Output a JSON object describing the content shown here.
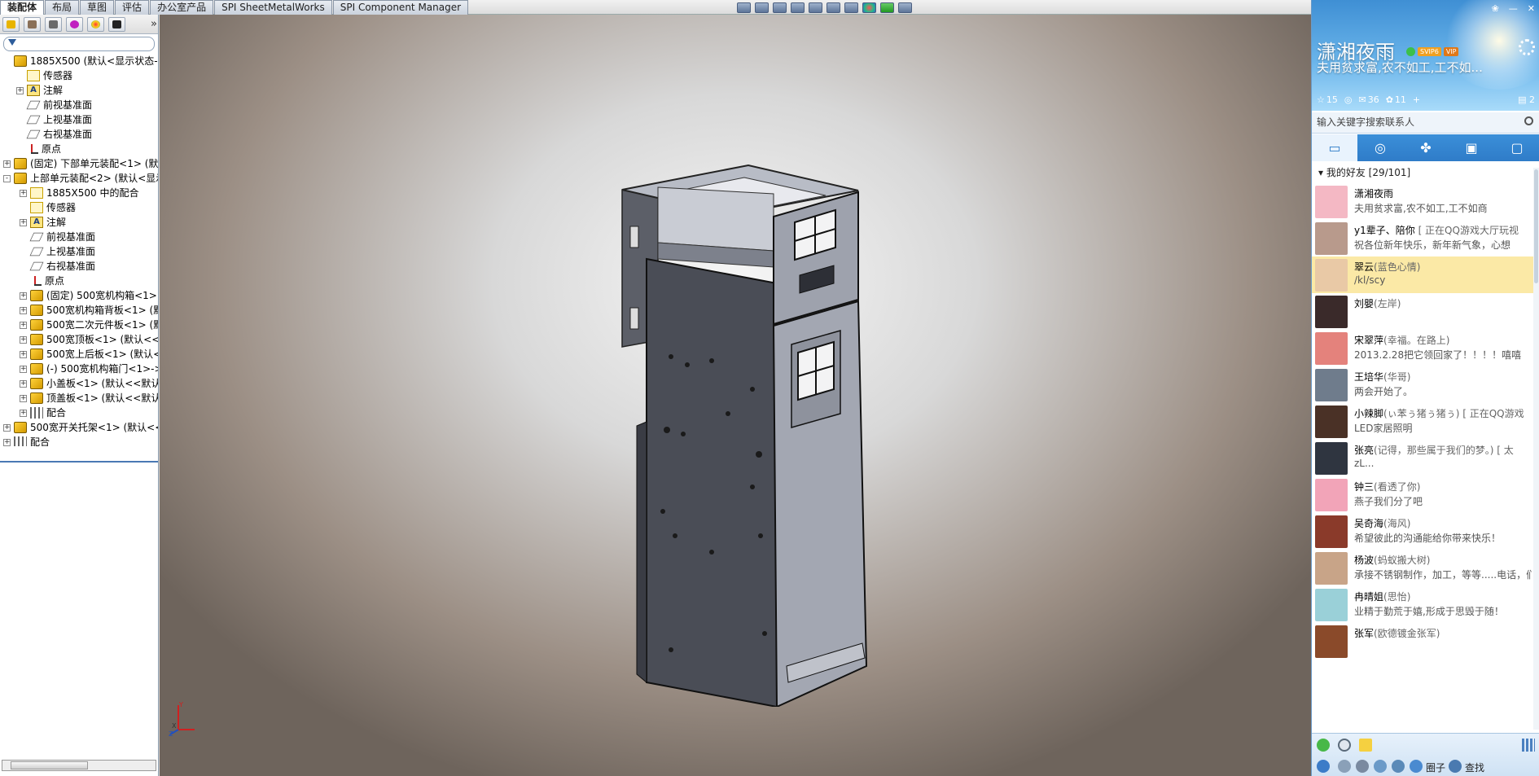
{
  "tabs": [
    "装配体",
    "布局",
    "草图",
    "评估",
    "办公室产品",
    "SPI SheetMetalWorks",
    "SPI Component Manager"
  ],
  "view_toolbar_icons": [
    "zoom-to-fit-icon",
    "zoom-area-icon",
    "previous-view-icon",
    "section-view-icon",
    "view-orientation-icon",
    "display-style-icon",
    "hide-show-icon",
    "edit-appearance-icon",
    "apply-scene-icon",
    "view-settings-icon"
  ],
  "tree": {
    "root": "1885X500 (默认<显示状态-1>)",
    "sensors": "传感器",
    "annotations": "注解",
    "front_plane": "前视基准面",
    "top_plane": "上视基准面",
    "right_plane": "右视基准面",
    "origin": "原点",
    "lower_unit": "(固定) 下部单元装配<1> (默认",
    "upper_unit": "上部单元装配<2> (默认<显示",
    "mates_in": "1885X500 中的配合",
    "sub_sensors": "传感器",
    "sub_annotations": "注解",
    "sub_front": "前视基准面",
    "sub_top": "上视基准面",
    "sub_right": "右视基准面",
    "sub_origin": "原点",
    "box": "(固定) 500宽机构箱<1> -:",
    "box_back": "500宽机构箱背板<1> (默认",
    "secondary_plate": "500宽二次元件板<1> (默认",
    "top_plate": "500宽顶板<1> (默认<<默",
    "upper_back": "500宽上后板<1> (默认<<",
    "box_door": "(-) 500宽机构箱门<1>->?",
    "small_cover": "小盖板<1> (默认<<默认",
    "top_cover": "顶盖板<1> (默认<<默认:",
    "sub_mates": "配合",
    "switch_bracket": "500宽开关托架<1> (默认<<默",
    "mates": "配合"
  },
  "qq": {
    "nickname": "潇湘夜雨",
    "signature": "夫用贫求富,农不如工,工不如...",
    "badge_vip": "SVIP6",
    "badge_level": "VIP",
    "stats": {
      "favorites": "15",
      "mail": "36",
      "qzone": "11",
      "right_count": "2"
    },
    "search_placeholder": "输入关键字搜索联系人",
    "group_label": "我的好友  [29/101]",
    "friends": [
      {
        "name": "潇湘夜雨",
        "remark": "",
        "sig": "夫用贫求富,农不如工,工不如商",
        "avatar_color": "#f4b8c4"
      },
      {
        "name": "y1辈子、陪你",
        "remark": " [ 正在QQ游戏大厅玩视",
        "sig": "祝各位新年快乐，新年新气象，心想",
        "avatar_color": "#b89a8c"
      },
      {
        "name": "翠云",
        "remark": "(蓝色心情)",
        "sig": "/kl/scy",
        "avatar_color": "#e9c9a6"
      },
      {
        "name": "刘嬰",
        "remark": "(左岸)",
        "sig": "",
        "avatar_color": "#3a2a2a"
      },
      {
        "name": "宋翠萍",
        "remark": "(幸福。在路上)",
        "sig": "2013.2.28把它领回家了！！！！嘻嘻",
        "avatar_color": "#e4827c"
      },
      {
        "name": "王培华",
        "remark": "(华哥)",
        "sig": "两会开始了。",
        "avatar_color": "#6f7c8c"
      },
      {
        "name": "小辣脚",
        "remark": "(ぃ苯ぅ猪ぅ猪ぅ) [ 正在QQ游戏",
        "sig": "LED家居照明",
        "avatar_color": "#4a3126"
      },
      {
        "name": "张亮",
        "remark": "(记得，那些属于我们的梦。) [ 太",
        "sig": "zL...",
        "avatar_color": "#2f3540"
      },
      {
        "name": "钟三",
        "remark": "(看透了你)",
        "sig": "燕子我们分了吧",
        "avatar_color": "#f2a4b8"
      },
      {
        "name": "吴奇海",
        "remark": "(海风)",
        "sig": "希望彼此的沟通能给你带来快乐！",
        "avatar_color": "#8a3a2a"
      },
      {
        "name": "杨波",
        "remark": "(蚂蚁搬大树)",
        "sig": "承接不锈钢制作，加工，等等.....电话，们",
        "avatar_color": "#c8a488"
      },
      {
        "name": "冉晴姐",
        "remark": "(思怡)",
        "sig": "业精于勤荒于嬉,形成于思毁于随！",
        "avatar_color": "#9ad0d8"
      },
      {
        "name": "张军",
        "remark": "(欧德镀金张军)",
        "sig": "",
        "avatar_color": "#8a4a2a"
      }
    ],
    "bottom": {
      "groups_label": "圈子",
      "find_label": "查找"
    }
  }
}
